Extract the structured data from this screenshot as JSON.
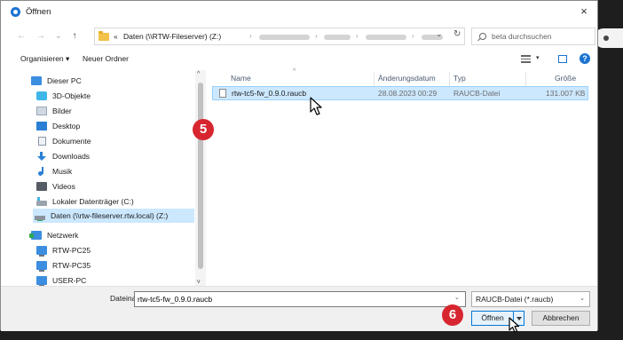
{
  "window": {
    "title": "Öffnen",
    "close_glyph": "×"
  },
  "address": {
    "back_glyph": "←",
    "forward_glyph": "→",
    "history_glyph": "⌄",
    "up_glyph": "↑",
    "prefix": "«",
    "first_crumb": "Daten (\\\\RTW-Fileserver) (Z:)",
    "separator": "›",
    "chevron": "⌄",
    "refresh_glyph": "↻"
  },
  "search": {
    "placeholder": "beta durchsuchen"
  },
  "toolbar": {
    "organize_label": "Organisieren ▾",
    "new_folder_label": "Neuer Ordner",
    "view_chevron": "▾",
    "help_glyph": "?"
  },
  "nav": {
    "items": [
      {
        "label": "Dieser PC",
        "icon": "pc-icon"
      },
      {
        "label": "3D-Objekte",
        "icon": "3d-objects-icon"
      },
      {
        "label": "Bilder",
        "icon": "pictures-icon"
      },
      {
        "label": "Desktop",
        "icon": "desktop-icon"
      },
      {
        "label": "Dokumente",
        "icon": "documents-icon"
      },
      {
        "label": "Downloads",
        "icon": "downloads-icon"
      },
      {
        "label": "Musik",
        "icon": "music-icon"
      },
      {
        "label": "Videos",
        "icon": "videos-icon"
      },
      {
        "label": "Lokaler Datenträger (C:)",
        "icon": "local-drive-icon"
      },
      {
        "label": "Daten (\\\\rtw-fileserver.rtw.local) (Z:)",
        "icon": "network-drive-icon"
      },
      {
        "label": "Netzwerk",
        "icon": "network-icon"
      },
      {
        "label": "RTW-PC25",
        "icon": "computer-icon"
      },
      {
        "label": "RTW-PC35",
        "icon": "computer-icon"
      },
      {
        "label": "USER-PC",
        "icon": "computer-icon"
      }
    ]
  },
  "columns": {
    "name": "Name",
    "date": "Änderungsdatum",
    "type": "Typ",
    "size": "Größe",
    "sort_glyph": "^"
  },
  "files": [
    {
      "name": "rtw-tc5-fw_0.9.0.raucb",
      "date": "28.08.2023 00:29",
      "type": "RAUCB-Datei",
      "size": "131.007 KB"
    }
  ],
  "footer": {
    "filename_label": "Dateiname:",
    "filename_value": "rtw-tc5-fw_0.9.0.raucb",
    "filename_chevron": "⌄",
    "filetype_value": "RAUCB-Datei (*.raucb)",
    "filetype_chevron": "⌄",
    "open_label": "Öffnen",
    "cancel_label": "Abbrechen"
  },
  "steps": {
    "step5": "5",
    "step6": "6"
  },
  "scroll": {
    "up_glyph": "^",
    "down_glyph": "v"
  },
  "colors": {
    "selection": "#cce8ff",
    "accent": "#0078d7",
    "step_marker": "#d7262f"
  }
}
